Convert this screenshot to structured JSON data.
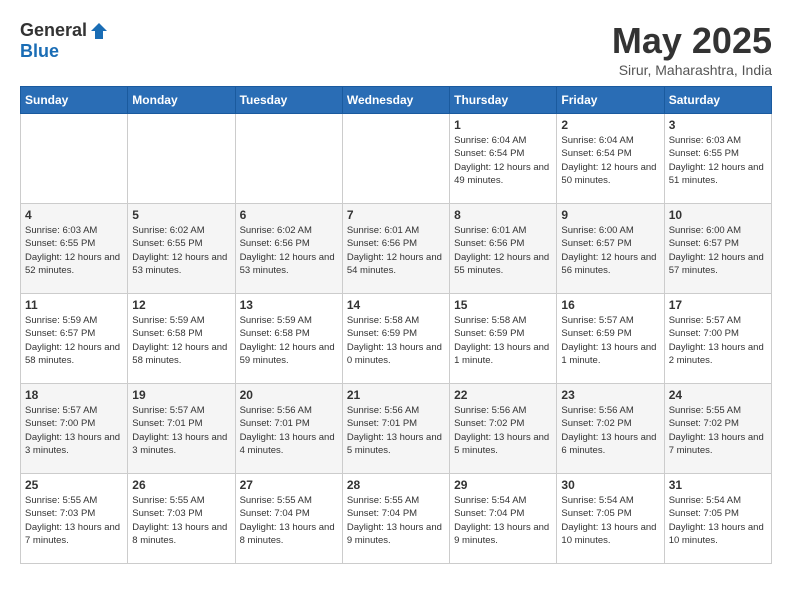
{
  "header": {
    "logo_general": "General",
    "logo_blue": "Blue",
    "month_title": "May 2025",
    "subtitle": "Sirur, Maharashtra, India"
  },
  "days_of_week": [
    "Sunday",
    "Monday",
    "Tuesday",
    "Wednesday",
    "Thursday",
    "Friday",
    "Saturday"
  ],
  "weeks": [
    [
      {
        "day": "",
        "sunrise": "",
        "sunset": "",
        "daylight": ""
      },
      {
        "day": "",
        "sunrise": "",
        "sunset": "",
        "daylight": ""
      },
      {
        "day": "",
        "sunrise": "",
        "sunset": "",
        "daylight": ""
      },
      {
        "day": "",
        "sunrise": "",
        "sunset": "",
        "daylight": ""
      },
      {
        "day": "1",
        "sunrise": "Sunrise: 6:04 AM",
        "sunset": "Sunset: 6:54 PM",
        "daylight": "Daylight: 12 hours and 49 minutes."
      },
      {
        "day": "2",
        "sunrise": "Sunrise: 6:04 AM",
        "sunset": "Sunset: 6:54 PM",
        "daylight": "Daylight: 12 hours and 50 minutes."
      },
      {
        "day": "3",
        "sunrise": "Sunrise: 6:03 AM",
        "sunset": "Sunset: 6:55 PM",
        "daylight": "Daylight: 12 hours and 51 minutes."
      }
    ],
    [
      {
        "day": "4",
        "sunrise": "Sunrise: 6:03 AM",
        "sunset": "Sunset: 6:55 PM",
        "daylight": "Daylight: 12 hours and 52 minutes."
      },
      {
        "day": "5",
        "sunrise": "Sunrise: 6:02 AM",
        "sunset": "Sunset: 6:55 PM",
        "daylight": "Daylight: 12 hours and 53 minutes."
      },
      {
        "day": "6",
        "sunrise": "Sunrise: 6:02 AM",
        "sunset": "Sunset: 6:56 PM",
        "daylight": "Daylight: 12 hours and 53 minutes."
      },
      {
        "day": "7",
        "sunrise": "Sunrise: 6:01 AM",
        "sunset": "Sunset: 6:56 PM",
        "daylight": "Daylight: 12 hours and 54 minutes."
      },
      {
        "day": "8",
        "sunrise": "Sunrise: 6:01 AM",
        "sunset": "Sunset: 6:56 PM",
        "daylight": "Daylight: 12 hours and 55 minutes."
      },
      {
        "day": "9",
        "sunrise": "Sunrise: 6:00 AM",
        "sunset": "Sunset: 6:57 PM",
        "daylight": "Daylight: 12 hours and 56 minutes."
      },
      {
        "day": "10",
        "sunrise": "Sunrise: 6:00 AM",
        "sunset": "Sunset: 6:57 PM",
        "daylight": "Daylight: 12 hours and 57 minutes."
      }
    ],
    [
      {
        "day": "11",
        "sunrise": "Sunrise: 5:59 AM",
        "sunset": "Sunset: 6:57 PM",
        "daylight": "Daylight: 12 hours and 58 minutes."
      },
      {
        "day": "12",
        "sunrise": "Sunrise: 5:59 AM",
        "sunset": "Sunset: 6:58 PM",
        "daylight": "Daylight: 12 hours and 58 minutes."
      },
      {
        "day": "13",
        "sunrise": "Sunrise: 5:59 AM",
        "sunset": "Sunset: 6:58 PM",
        "daylight": "Daylight: 12 hours and 59 minutes."
      },
      {
        "day": "14",
        "sunrise": "Sunrise: 5:58 AM",
        "sunset": "Sunset: 6:59 PM",
        "daylight": "Daylight: 13 hours and 0 minutes."
      },
      {
        "day": "15",
        "sunrise": "Sunrise: 5:58 AM",
        "sunset": "Sunset: 6:59 PM",
        "daylight": "Daylight: 13 hours and 1 minute."
      },
      {
        "day": "16",
        "sunrise": "Sunrise: 5:57 AM",
        "sunset": "Sunset: 6:59 PM",
        "daylight": "Daylight: 13 hours and 1 minute."
      },
      {
        "day": "17",
        "sunrise": "Sunrise: 5:57 AM",
        "sunset": "Sunset: 7:00 PM",
        "daylight": "Daylight: 13 hours and 2 minutes."
      }
    ],
    [
      {
        "day": "18",
        "sunrise": "Sunrise: 5:57 AM",
        "sunset": "Sunset: 7:00 PM",
        "daylight": "Daylight: 13 hours and 3 minutes."
      },
      {
        "day": "19",
        "sunrise": "Sunrise: 5:57 AM",
        "sunset": "Sunset: 7:01 PM",
        "daylight": "Daylight: 13 hours and 3 minutes."
      },
      {
        "day": "20",
        "sunrise": "Sunrise: 5:56 AM",
        "sunset": "Sunset: 7:01 PM",
        "daylight": "Daylight: 13 hours and 4 minutes."
      },
      {
        "day": "21",
        "sunrise": "Sunrise: 5:56 AM",
        "sunset": "Sunset: 7:01 PM",
        "daylight": "Daylight: 13 hours and 5 minutes."
      },
      {
        "day": "22",
        "sunrise": "Sunrise: 5:56 AM",
        "sunset": "Sunset: 7:02 PM",
        "daylight": "Daylight: 13 hours and 5 minutes."
      },
      {
        "day": "23",
        "sunrise": "Sunrise: 5:56 AM",
        "sunset": "Sunset: 7:02 PM",
        "daylight": "Daylight: 13 hours and 6 minutes."
      },
      {
        "day": "24",
        "sunrise": "Sunrise: 5:55 AM",
        "sunset": "Sunset: 7:02 PM",
        "daylight": "Daylight: 13 hours and 7 minutes."
      }
    ],
    [
      {
        "day": "25",
        "sunrise": "Sunrise: 5:55 AM",
        "sunset": "Sunset: 7:03 PM",
        "daylight": "Daylight: 13 hours and 7 minutes."
      },
      {
        "day": "26",
        "sunrise": "Sunrise: 5:55 AM",
        "sunset": "Sunset: 7:03 PM",
        "daylight": "Daylight: 13 hours and 8 minutes."
      },
      {
        "day": "27",
        "sunrise": "Sunrise: 5:55 AM",
        "sunset": "Sunset: 7:04 PM",
        "daylight": "Daylight: 13 hours and 8 minutes."
      },
      {
        "day": "28",
        "sunrise": "Sunrise: 5:55 AM",
        "sunset": "Sunset: 7:04 PM",
        "daylight": "Daylight: 13 hours and 9 minutes."
      },
      {
        "day": "29",
        "sunrise": "Sunrise: 5:54 AM",
        "sunset": "Sunset: 7:04 PM",
        "daylight": "Daylight: 13 hours and 9 minutes."
      },
      {
        "day": "30",
        "sunrise": "Sunrise: 5:54 AM",
        "sunset": "Sunset: 7:05 PM",
        "daylight": "Daylight: 13 hours and 10 minutes."
      },
      {
        "day": "31",
        "sunrise": "Sunrise: 5:54 AM",
        "sunset": "Sunset: 7:05 PM",
        "daylight": "Daylight: 13 hours and 10 minutes."
      }
    ]
  ]
}
